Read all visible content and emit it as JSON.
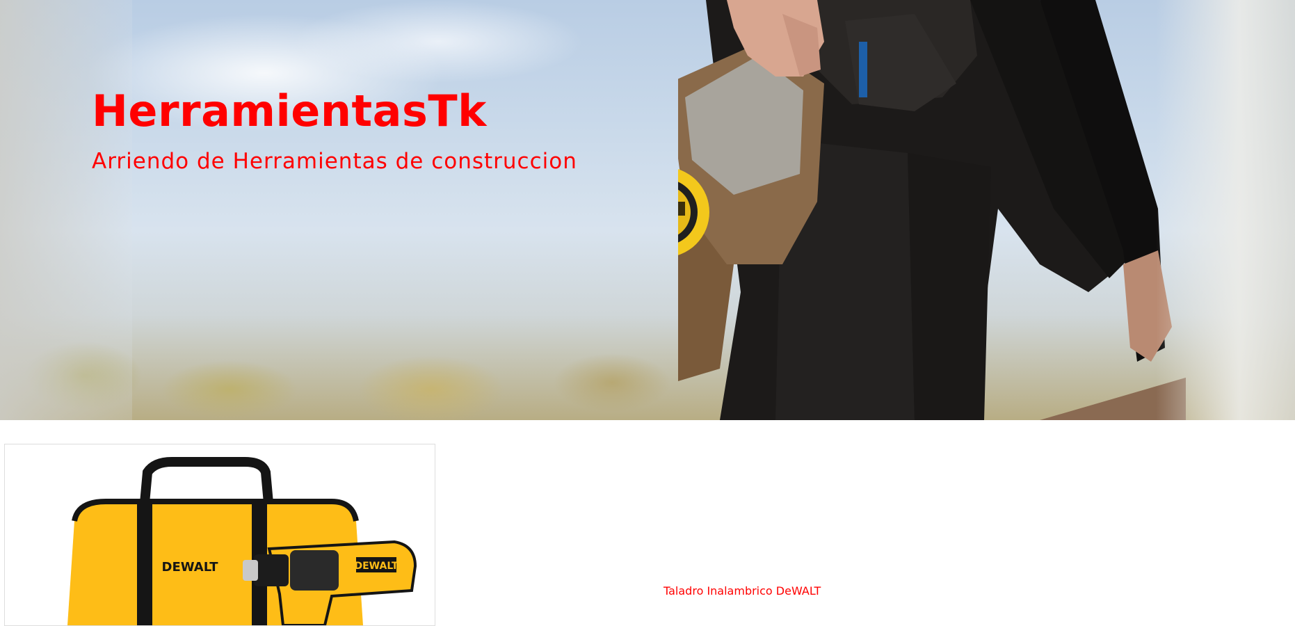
{
  "hero": {
    "title": "HerramientasTk",
    "subtitle": "Arriendo de Herramientas de construccion"
  },
  "products": [
    {
      "name": "Taladro Inalambrico DeWALT",
      "image": "dewalt-drill-kit-image",
      "brand_marks": [
        "DEWALT",
        "DEWALT"
      ]
    }
  ],
  "colors": {
    "accent": "#ff0000",
    "dewalt_yellow": "#febd17",
    "background": "#ffffff"
  }
}
